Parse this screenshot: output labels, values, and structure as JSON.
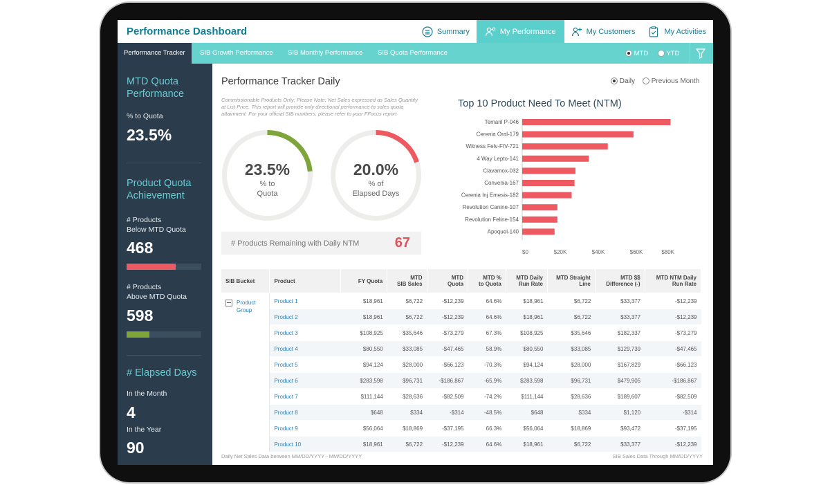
{
  "app": {
    "title": "Performance Dashboard"
  },
  "nav": [
    {
      "label": "Summary",
      "icon": "list-icon",
      "active": false
    },
    {
      "label": "My Performance",
      "icon": "people-network-icon",
      "active": true
    },
    {
      "label": "My Customers",
      "icon": "add-user-icon",
      "active": false
    },
    {
      "label": "My Activities",
      "icon": "clipboard-icon",
      "active": false
    }
  ],
  "subnav": {
    "tabs": [
      "Performance Tracker",
      "SIB Growth Performance",
      "SIB Monthly Performance",
      "SIB Quota Performance"
    ],
    "period": {
      "mtd": "MTD",
      "ytd": "YTD",
      "selected": "MTD"
    },
    "filter_icon": "filter-icon"
  },
  "sidebar": {
    "mtd": {
      "heading": "MTD Quota Performance",
      "label": "% to Quota",
      "value": "23.5%"
    },
    "product": {
      "heading": "Product Quota Achievement",
      "below_label_1": "# Products",
      "below_label_2": "Below MTD Quota",
      "below_value": "468",
      "below_fraction": 0.66,
      "above_label_1": "# Products",
      "above_label_2": "Above MTD Quota",
      "above_value": "598",
      "above_fraction": 0.31
    },
    "elapsed": {
      "heading": "# Elapsed Days",
      "month_label": "In the Month",
      "month_value": "4",
      "year_label": "In the Year",
      "year_value": "90"
    }
  },
  "main": {
    "title": "Performance Tracker Daily",
    "toggle": {
      "daily": "Daily",
      "prev": "Previous Month",
      "selected": "Daily"
    },
    "note": "Commissionable Products Only; Please Note: Net Sales expressed as Sales Quantity at List Price. This report will provide only directional performance to sales quota attainment. For your official SIB numbers, please refer to your FFocus report",
    "donut1": {
      "value": "23.5%",
      "label_1": "% to",
      "label_2": "Quota",
      "fraction": 0.235,
      "color": "#7ea53a"
    },
    "donut2": {
      "value": "20.0%",
      "label_1": "% of",
      "label_2": "Elapsed Days",
      "fraction": 0.2,
      "color": "#ee5a62"
    },
    "remaining": {
      "label": "# Products Remaining with Daily NTM",
      "value": "67"
    },
    "footer_left": "Daily Net Sales Data between MM/DD/YYYY - MM/DD/YYYY",
    "footer_right": "SIB Sales Data Through MM/DD/YYYY"
  },
  "chart_data": {
    "type": "bar",
    "title": "Top 10 Product Need To Meet (NTM)",
    "orientation": "horizontal",
    "categories": [
      "Temaril P-046",
      "Cerenia Oral-179",
      "Witness Felv-FIV-721",
      "4 Way Lepto-141",
      "Clavamox-032",
      "Convenia-167",
      "Cerenia Inj Emesis-182",
      "Revolution Canine-107",
      "Revolution Feline-154",
      "Apoquel-140"
    ],
    "values": [
      78000,
      58500,
      45000,
      35000,
      28000,
      27500,
      26000,
      18500,
      18500,
      17000
    ],
    "xlim": [
      0,
      80000
    ],
    "xticks": [
      "$0",
      "$20K",
      "$40K",
      "$60K",
      "$80K"
    ],
    "color": "#ee5a62"
  },
  "table": {
    "headers": [
      {
        "l1": "SIB Bucket",
        "l2": ""
      },
      {
        "l1": "Product",
        "l2": ""
      },
      {
        "l1": "FY Quota",
        "l2": ""
      },
      {
        "l1": "MTD",
        "l2": "SIB Sales"
      },
      {
        "l1": "MTD",
        "l2": "Quota"
      },
      {
        "l1": "MTD %",
        "l2": "to Quota"
      },
      {
        "l1": "MTD Daily",
        "l2": "Run Rate"
      },
      {
        "l1": "MTD Straight",
        "l2": "Line"
      },
      {
        "l1": "MTD $$",
        "l2": "Difference (-)"
      },
      {
        "l1": "MTD NTM Daily",
        "l2": "Run Rate"
      }
    ],
    "bucket": {
      "line1": "Product",
      "line2": "Group",
      "icon": "collapse-icon"
    },
    "rows": [
      {
        "product": "Product 1",
        "fy": "$18,961",
        "sales": "$6,722",
        "quota": "-$12,239",
        "pct": "64.6%",
        "pct_pos": true,
        "run": "$18,961",
        "line": "$6,722",
        "diff": "$33,377",
        "ntm": "-$12,239"
      },
      {
        "product": "Product 2",
        "fy": "$18,961",
        "sales": "$6,722",
        "quota": "-$12,239",
        "pct": "64.6%",
        "pct_pos": true,
        "run": "$18,961",
        "line": "$6,722",
        "diff": "$33,377",
        "ntm": "-$12,239"
      },
      {
        "product": "Product 3",
        "fy": "$108,925",
        "sales": "$35,646",
        "quota": "-$73,279",
        "pct": "67.3%",
        "pct_pos": true,
        "run": "$108,925",
        "line": "$35,646",
        "diff": "$182,337",
        "ntm": "-$73,279"
      },
      {
        "product": "Product 4",
        "fy": "$80,550",
        "sales": "$33,085",
        "quota": "-$47,465",
        "pct": "58.9%",
        "pct_pos": true,
        "run": "$80,550",
        "line": "$33,085",
        "diff": "$129,739",
        "ntm": "-$47,465"
      },
      {
        "product": "Product 5",
        "fy": "$94,124",
        "sales": "$28,000",
        "quota": "-$66,123",
        "pct": "-70.3%",
        "pct_pos": false,
        "run": "$94,124",
        "line": "$28,000",
        "diff": "$167,829",
        "ntm": "-$66,123"
      },
      {
        "product": "Product 6",
        "fy": "$283,598",
        "sales": "$96,731",
        "quota": "-$186,867",
        "pct": "-65.9%",
        "pct_pos": false,
        "run": "$283,598",
        "line": "$96,731",
        "diff": "$479,905",
        "ntm": "-$186,867"
      },
      {
        "product": "Product 7",
        "fy": "$111,144",
        "sales": "$28,636",
        "quota": "-$82,509",
        "pct": "-74.2%",
        "pct_pos": false,
        "run": "$111,144",
        "line": "$28,636",
        "diff": "$189,607",
        "ntm": "-$82,509"
      },
      {
        "product": "Product 8",
        "fy": "$648",
        "sales": "$334",
        "quota": "-$314",
        "pct": "-48.5%",
        "pct_pos": false,
        "run": "$648",
        "line": "$334",
        "diff": "$1,120",
        "ntm": "-$314"
      },
      {
        "product": "Product 9",
        "fy": "$56,064",
        "sales": "$18,869",
        "quota": "-$37,195",
        "pct": "66.3%",
        "pct_pos": true,
        "run": "$56,064",
        "line": "$18,869",
        "diff": "$93,472",
        "ntm": "-$37,195"
      },
      {
        "product": "Product 10",
        "fy": "$18,961",
        "sales": "$6,722",
        "quota": "-$12,239",
        "pct": "64.6%",
        "pct_pos": true,
        "run": "$18,961",
        "line": "$6,722",
        "diff": "$33,377",
        "ntm": "-$12,239"
      }
    ]
  }
}
